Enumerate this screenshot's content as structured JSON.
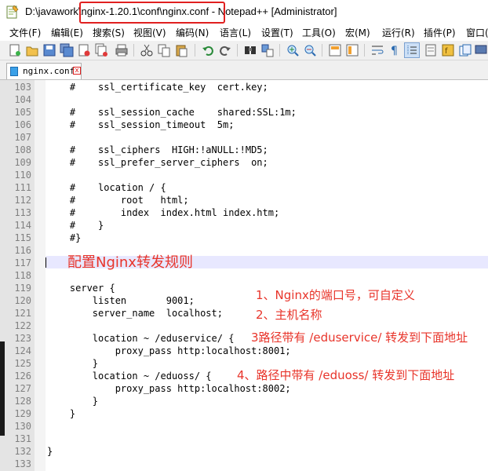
{
  "window": {
    "title": "D:\\javawork\\nginx-1.20.1\\conf\\nginx.conf - Notepad++ [Administrator]"
  },
  "menu": [
    "文件(F)",
    "编辑(E)",
    "搜索(S)",
    "视图(V)",
    "编码(N)",
    "语言(L)",
    "设置(T)",
    "工具(O)",
    "宏(M)",
    "运行(R)",
    "插件(P)",
    "窗口("
  ],
  "toolbar_icons": [
    "new-file-icon",
    "open-file-icon",
    "save-icon",
    "save-all-icon",
    "close-icon",
    "close-all-icon",
    "print-icon",
    "cut-icon",
    "copy-icon",
    "paste-icon",
    "undo-icon",
    "redo-icon",
    "find-icon",
    "replace-icon",
    "zoom-in-icon",
    "zoom-out-icon",
    "sync-v-icon",
    "sync-h-icon",
    "wrap-icon",
    "show-all-icon",
    "indent-guide-icon",
    "doc-map-icon",
    "function-list-icon",
    "folder-workspace-icon",
    "monitor-icon"
  ],
  "tab": {
    "label": "nginx.conf",
    "close": "x"
  },
  "editor": {
    "lines": [
      {
        "n": "103",
        "t": "    #    ssl_certificate_key  cert.key;"
      },
      {
        "n": "104",
        "t": ""
      },
      {
        "n": "105",
        "t": "    #    ssl_session_cache    shared:SSL:1m;"
      },
      {
        "n": "106",
        "t": "    #    ssl_session_timeout  5m;"
      },
      {
        "n": "107",
        "t": ""
      },
      {
        "n": "108",
        "t": "    #    ssl_ciphers  HIGH:!aNULL:!MD5;"
      },
      {
        "n": "109",
        "t": "    #    ssl_prefer_server_ciphers  on;"
      },
      {
        "n": "110",
        "t": ""
      },
      {
        "n": "111",
        "t": "    #    location / {"
      },
      {
        "n": "112",
        "t": "    #        root   html;"
      },
      {
        "n": "113",
        "t": "    #        index  index.html index.htm;"
      },
      {
        "n": "114",
        "t": "    #    }"
      },
      {
        "n": "115",
        "t": "    #}"
      },
      {
        "n": "116",
        "t": ""
      },
      {
        "n": "117",
        "t": ""
      },
      {
        "n": "118",
        "t": ""
      },
      {
        "n": "119",
        "t": "    server {"
      },
      {
        "n": "120",
        "t": "        listen       9001;"
      },
      {
        "n": "121",
        "t": "        server_name  localhost;"
      },
      {
        "n": "122",
        "t": ""
      },
      {
        "n": "123",
        "t": "        location ~ /eduservice/ {"
      },
      {
        "n": "124",
        "t": "            proxy_pass http:localhost:8001;"
      },
      {
        "n": "125",
        "t": "        }"
      },
      {
        "n": "126",
        "t": "        location ~ /eduoss/ {"
      },
      {
        "n": "127",
        "t": "            proxy_pass http:localhost:8002;"
      },
      {
        "n": "128",
        "t": "        }"
      },
      {
        "n": "129",
        "t": "    }"
      },
      {
        "n": "130",
        "t": ""
      },
      {
        "n": "131",
        "t": ""
      },
      {
        "n": "132",
        "t": "}"
      },
      {
        "n": "133",
        "t": ""
      }
    ]
  },
  "annotations": {
    "heading": "配置Nginx转发规则",
    "note1": "1、Nginx的端口号，可自定义",
    "note2": "2、主机名称",
    "note3": "3路径带有 /eduservice/  转发到下面地址",
    "note4": "4、路径中带有 /eduoss/ 转发到下面地址"
  },
  "colors": {
    "annotation": "#e8342a",
    "highlight_box": "#e02020",
    "current_line": "#e8e8ff"
  }
}
